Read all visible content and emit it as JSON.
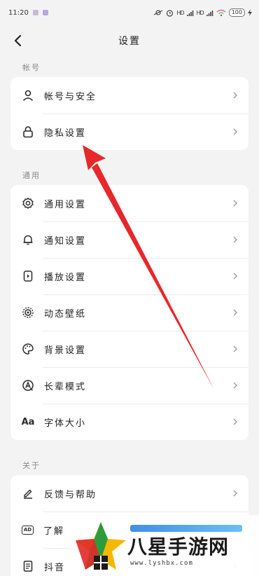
{
  "status_bar": {
    "time": "11:20",
    "signal_text_1": "HD",
    "signal_text_2": "HD",
    "battery": "100"
  },
  "header": {
    "title": "设置",
    "back_icon": "chevron-left-icon"
  },
  "sections": [
    {
      "label": "帐号",
      "items": [
        {
          "label": "帐号与安全",
          "icon": "user-icon"
        },
        {
          "label": "隐私设置",
          "icon": "lock-icon"
        }
      ]
    },
    {
      "label": "通用",
      "items": [
        {
          "label": "通用设置",
          "icon": "gear-icon"
        },
        {
          "label": "通知设置",
          "icon": "bell-icon"
        },
        {
          "label": "播放设置",
          "icon": "play-device-icon"
        },
        {
          "label": "动态壁纸",
          "icon": "live-wallpaper-icon"
        },
        {
          "label": "背景设置",
          "icon": "palette-icon"
        },
        {
          "label": "长辈模式",
          "icon": "elder-mode-icon"
        },
        {
          "label": "字体大小",
          "icon": "font-size-icon",
          "icon_text": "Aa"
        }
      ]
    },
    {
      "label": "关于",
      "items": [
        {
          "label": "反馈与帮助",
          "icon": "edit-icon"
        },
        {
          "label": "了解",
          "icon": "ad-icon",
          "icon_text": "AD"
        },
        {
          "label": "抖音",
          "icon": "document-icon"
        }
      ]
    }
  ],
  "watermark": {
    "title": "八星手游网",
    "url": "www.lyshbx.com"
  },
  "colors": {
    "background": "#f3f3f3",
    "card": "#ffffff",
    "annotation_arrow": "#e8272a"
  }
}
